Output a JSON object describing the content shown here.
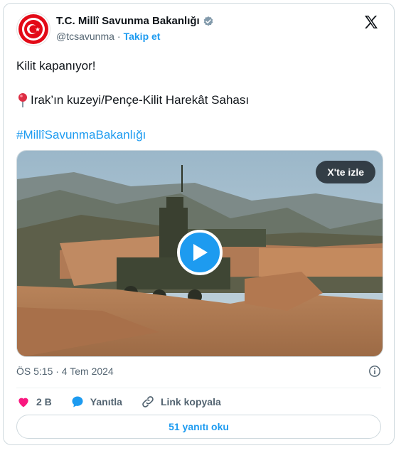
{
  "author": {
    "name": "T.C. Millî Savunma Bakanlığı",
    "handle": "@tcsavunma",
    "separator": "·",
    "follow_label": "Takip et",
    "avatar_icon": "ministry-seal-icon",
    "verified_icon": "verified-badge-icon"
  },
  "platform_icon": "x-logo-icon",
  "tweet": {
    "line1": "Kilit kapanıyor!",
    "line2_icon": "round-pushpin-icon",
    "line2": "Irak’ın kuzeyi/Pençe-Kilit Harekât Sahası",
    "hashtag": "#MillîSavunmaBakanlığı"
  },
  "media": {
    "watch_label": "X'te izle",
    "play_icon": "play-icon"
  },
  "timestamp": "ÖS 5:15 · 4 Tem 2024",
  "actions": {
    "like_count": "2 B",
    "reply_label": "Yanıtla",
    "copy_label": "Link kopyala"
  },
  "replies_button": "51 yanıtı oku",
  "colors": {
    "accent": "#1d9bf0",
    "like": "#f91880",
    "muted": "#536471",
    "seal": "#e30a17"
  }
}
